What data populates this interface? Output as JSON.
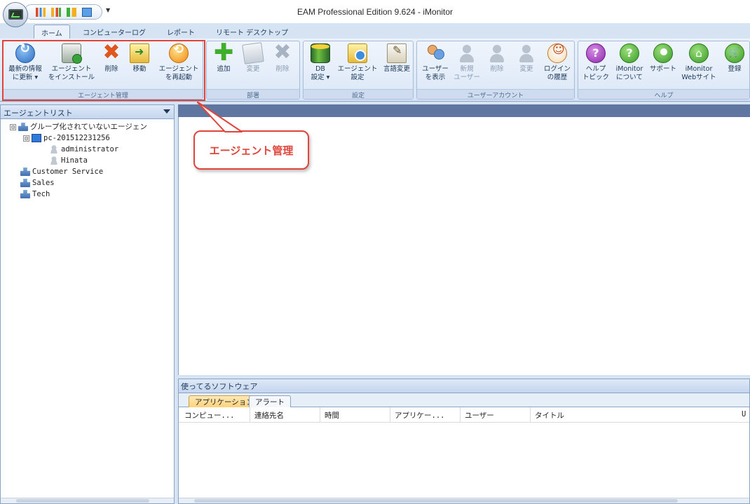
{
  "window": {
    "title": "EAM Professional Edition 9.624 - iMonitor"
  },
  "ribbon": {
    "tabs": [
      "ホーム",
      "コンピューターログ",
      "レポート",
      "リモート デスクトップ"
    ],
    "groups": {
      "agent": {
        "label": "エージェント管理",
        "refresh": [
          "最新の情報",
          "に更新"
        ],
        "install": [
          "エージェント",
          "をインストール"
        ],
        "delete": "削除",
        "move": "移動",
        "restart": [
          "エージェント",
          "を再起動"
        ]
      },
      "dept": {
        "label": "部署",
        "add": "追加",
        "edit": "変更",
        "delete": "削除"
      },
      "settings": {
        "label": "設定",
        "db": [
          "DB",
          "設定"
        ],
        "agent": [
          "エージェント",
          "設定"
        ],
        "lang": "言語変更"
      },
      "user": {
        "label": "ユーザーアカウント",
        "show": [
          "ユーザー",
          "を表示"
        ],
        "new": [
          "新規",
          "ユーザー"
        ],
        "delete": "削除",
        "edit": "変更",
        "history": [
          "ログイン",
          "の履歴"
        ]
      },
      "help": {
        "label": "ヘルプ",
        "topics": [
          "ヘルプ",
          "トピック"
        ],
        "about": [
          "iMonitor",
          "について"
        ],
        "support": "サポート",
        "website": [
          "iMonitor",
          "Webサイト"
        ],
        "register": "登録"
      }
    }
  },
  "agent_list": {
    "title": "エージェントリスト",
    "tree": [
      {
        "label": "グループ化されていないエージェン",
        "kind": "group",
        "expander": "⊟"
      },
      {
        "label": "pc-201512231256",
        "kind": "pc",
        "expander": "⊟"
      },
      {
        "label": "administrator",
        "kind": "user"
      },
      {
        "label": "Hinata",
        "kind": "user"
      },
      {
        "label": "Customer Service",
        "kind": "group"
      },
      {
        "label": "Sales",
        "kind": "group"
      },
      {
        "label": "Tech",
        "kind": "group"
      }
    ]
  },
  "callout": {
    "text": "エージェント管理"
  },
  "bottom": {
    "title": "使ってるソフトウェア",
    "tabs": [
      "アプリケーション",
      "アラート"
    ],
    "columns": [
      "コンピュー...",
      "連絡先名",
      "時間",
      "アプリケー...",
      "ユーザー",
      "タイトル",
      "U"
    ]
  },
  "colors": {
    "accent_red": "#e0443a",
    "ribbon_bg": "#d5e3f3",
    "strip": "#5f77a0"
  }
}
